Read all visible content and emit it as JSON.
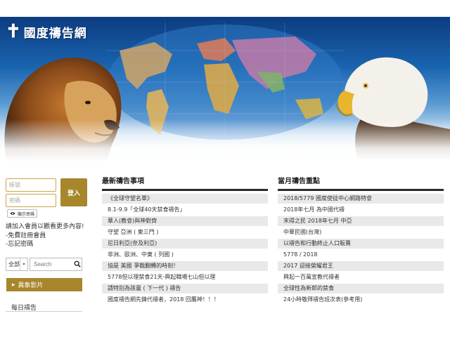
{
  "site": {
    "logo_cross": "✝",
    "name": "國度禱告網"
  },
  "login": {
    "account_placeholder": "帳號",
    "password_placeholder": "密碼",
    "login_button": "登入",
    "show_password": "顯示密碼",
    "join_text": "請加入會員以觀看更多內容!",
    "register_link": "-免費註冊會員",
    "forgot_link": "-忘記密碼"
  },
  "search": {
    "scope_value": "全部",
    "placeholder": "Search"
  },
  "video_button": "異象影片",
  "daily_prayer": "每日禱告",
  "latest": {
    "title": "最新禱告事項",
    "items": [
      "《全球守望名單》",
      "8.1-9.9「全球40天禁食禱告」",
      "華人(教會)與神對齊",
      "守望 亞洲 ( 東三門 )",
      "尼日利亞(奈及利亞)",
      "非洲、歐洲、中東 ( 列國 )",
      "協是 美國 爭戰翻轉的時刻！",
      "5778但以理禁食21天-興起職場七山但以理",
      "請特別為孩童 ( 下一代 ) 禱告",
      "國度禱告網先鋒代禱者，2018 回鷹神！！！"
    ]
  },
  "monthly": {
    "title": "當月禱告重點",
    "items": [
      "2018/5779 國度使徒中心網路特會",
      "2018年七月 為中國代禱",
      "末得之民 2018年七月 中亞",
      "中華民國(台灣)",
      "以禱告和行動終止人口販賣",
      "5778 / 2018",
      "2017 迎接榮耀君王",
      "興起一百萬宣教代禱者",
      "全球性為新郎的禁食",
      "24小時敬拜禱告班次表(參考用)"
    ]
  },
  "colors": {
    "gold": "#a8862c",
    "banner_blue": "#1a64b0",
    "row_alt": "#e9e9e9"
  }
}
